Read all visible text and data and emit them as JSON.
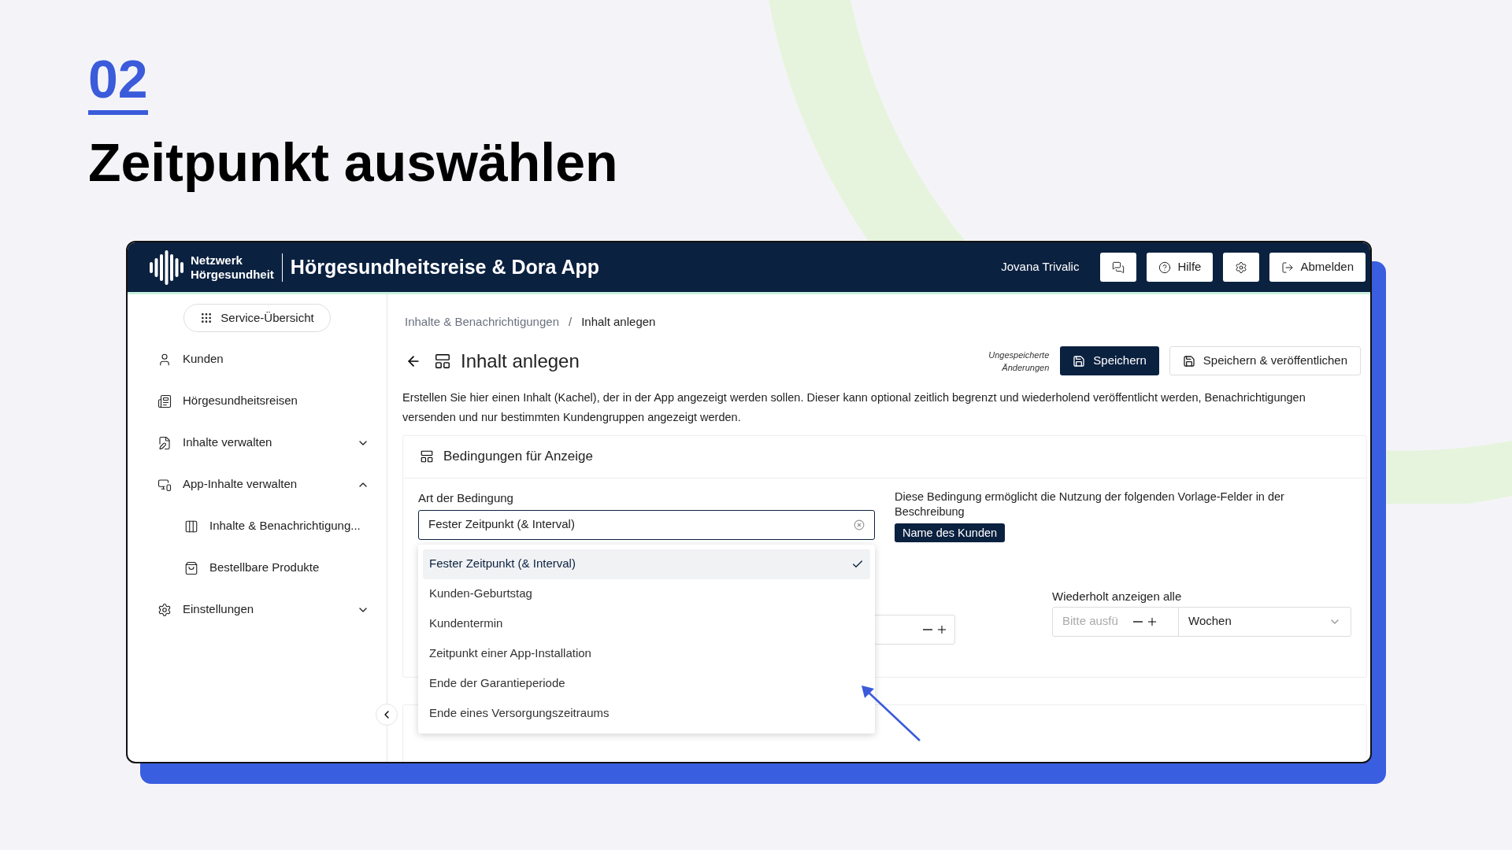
{
  "slide": {
    "number": "02",
    "title": "Zeitpunkt auswählen"
  },
  "header": {
    "brand_line1": "Netzwerk",
    "brand_line2": "Hörgesundheit",
    "title": "Hörgesundheitsreise & Dora App",
    "user": "Jovana Trivalic",
    "buttons": [
      {
        "kind": "chat"
      },
      {
        "kind": "help",
        "label": "Hilfe"
      },
      {
        "kind": "settings"
      },
      {
        "kind": "logout",
        "label": "Abmelden"
      }
    ]
  },
  "sidebar": {
    "service_button": "Service-Übersicht",
    "items": [
      {
        "label": "Kunden",
        "kind": "user"
      },
      {
        "label": "Hörgesundheitsreisen",
        "kind": "journey"
      },
      {
        "label": "Inhalte verwalten",
        "kind": "file",
        "expanded": false
      },
      {
        "label": "App-Inhalte verwalten",
        "kind": "devices",
        "expanded": true,
        "children": [
          {
            "label": "Inhalte & Benachrichtigung...",
            "kind": "cards"
          },
          {
            "label": "Bestellbare Produkte",
            "kind": "bag"
          }
        ]
      },
      {
        "label": "Einstellungen",
        "kind": "settings",
        "expanded": false
      }
    ]
  },
  "breadcrumb_separator": "/",
  "breadcrumb": [
    {
      "label": "Inhalte & Benachrichtigungen",
      "selected": false
    },
    {
      "label": "Inhalt anlegen",
      "selected": true
    }
  ],
  "page": {
    "title": "Inhalt anlegen",
    "unsaved_note": "Ungespeicherte Änderungen",
    "actions": [
      {
        "kind": "primary",
        "label": "Speichern"
      },
      {
        "kind": "secondary",
        "label": "Speichern & veröffentlichen"
      }
    ],
    "description": "Erstellen Sie hier einen Inhalt (Kachel), der in der App angezeigt werden sollen. Dieser kann optional zeitlich begrenzt und wiederholend veröffentlicht werden, Benachrichtigungen versenden und nur bestimmten Kundengruppen angezeigt werden."
  },
  "card": {
    "title": "Bedingungen für Anzeige",
    "condition_label": "Art der Bedingung",
    "condition_value": "Fester Zeitpunkt (& Interval)",
    "options": [
      {
        "label": "Fester Zeitpunkt (& Interval)",
        "selected": true
      },
      {
        "label": "Kunden-Geburtstag",
        "selected": false
      },
      {
        "label": "Kundentermin",
        "selected": false
      },
      {
        "label": "Zeitpunkt einer App-Installation",
        "selected": false
      },
      {
        "label": "Ende der Garantieperiode",
        "selected": false
      },
      {
        "label": "Ende eines Versorgungszeitraums",
        "selected": false
      }
    ],
    "info": "Diese Bedingung ermöglicht die Nutzung der folgenden Vorlage-Felder in der Beschreibung",
    "template_fields": [
      "Name des Kunden"
    ],
    "repeat_label": "Wiederholt anzeigen alle",
    "repeat_placeholder": "Bitte ausfü",
    "repeat_unit": "Wochen"
  }
}
